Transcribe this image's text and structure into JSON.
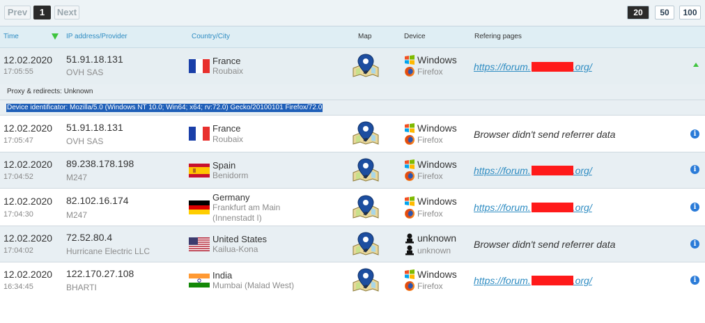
{
  "pagination": {
    "prev_label": "Prev",
    "current_page": "1",
    "next_label": "Next",
    "page_sizes": [
      "20",
      "50",
      "100"
    ],
    "active_page_size": "20"
  },
  "table": {
    "headers": {
      "time": "Time",
      "ip": "IP address/Provider",
      "country": "Country/City",
      "map": "Map",
      "device": "Device",
      "referring": "Refering pages"
    },
    "expanded_details": {
      "proxy": "Proxy & redirects: Unknown",
      "device_id": "Device identificator: Mozilla/5.0 (Windows NT 10.0; Win64; x64; rv:72.0) Gecko/20100101 Firefox/72.0"
    },
    "rows": [
      {
        "date": "12.02.2020",
        "time": "17:05:55",
        "ip": "51.91.18.131",
        "provider": "OVH SAS",
        "country": "France",
        "city": "Roubaix",
        "city2": "",
        "os": "Windows",
        "browser": "Firefox",
        "ref_prefix": "https://forum.",
        "ref_suffix": ".org/",
        "ref_none": ""
      },
      {
        "date": "12.02.2020",
        "time": "17:05:47",
        "ip": "51.91.18.131",
        "provider": "OVH SAS",
        "country": "France",
        "city": "Roubaix",
        "city2": "",
        "os": "Windows",
        "browser": "Firefox",
        "ref_prefix": "",
        "ref_suffix": "",
        "ref_none": "Browser didn't send referrer data"
      },
      {
        "date": "12.02.2020",
        "time": "17:04:52",
        "ip": "89.238.178.198",
        "provider": "M247",
        "country": "Spain",
        "city": "Benidorm",
        "city2": "",
        "os": "Windows",
        "browser": "Firefox",
        "ref_prefix": "https://forum.",
        "ref_suffix": ".org/",
        "ref_none": ""
      },
      {
        "date": "12.02.2020",
        "time": "17:04:30",
        "ip": "82.102.16.174",
        "provider": "M247",
        "country": "Germany",
        "city": "Frankfurt am Main",
        "city2": "(Innenstadt I)",
        "os": "Windows",
        "browser": "Firefox",
        "ref_prefix": "https://forum.",
        "ref_suffix": ".org/",
        "ref_none": ""
      },
      {
        "date": "12.02.2020",
        "time": "17:04:02",
        "ip": "72.52.80.4",
        "provider": "Hurricane Electric LLC",
        "country": "United States",
        "city": "Kailua-Kona",
        "city2": "",
        "os": "unknown",
        "browser": "unknown",
        "ref_prefix": "",
        "ref_suffix": "",
        "ref_none": "Browser didn't send referrer data"
      },
      {
        "date": "12.02.2020",
        "time": "16:34:45",
        "ip": "122.170.27.108",
        "provider": "BHARTI",
        "country": "India",
        "city": "Mumbai (Malad West)",
        "city2": "",
        "os": "Windows",
        "browser": "Firefox",
        "ref_prefix": "https://forum.",
        "ref_suffix": ".org/",
        "ref_none": ""
      }
    ]
  },
  "icons": {
    "map": "map-pin-ip-icon",
    "os": "windows-icon",
    "browser": "firefox-icon",
    "unknown_device": "unknown-user-icon",
    "info": "info-icon",
    "collapse": "collapse-arrow-icon",
    "sort": "sort-desc-icon"
  },
  "colors": {
    "link": "#2e8cc2",
    "redaction": "#ff1a1a",
    "header_bg": "#dfeef4",
    "alt_row_bg": "#e8eff3",
    "info": "#2a7bd8",
    "sort_indicator": "#3ec43e",
    "selection": "#1f5fb8"
  }
}
